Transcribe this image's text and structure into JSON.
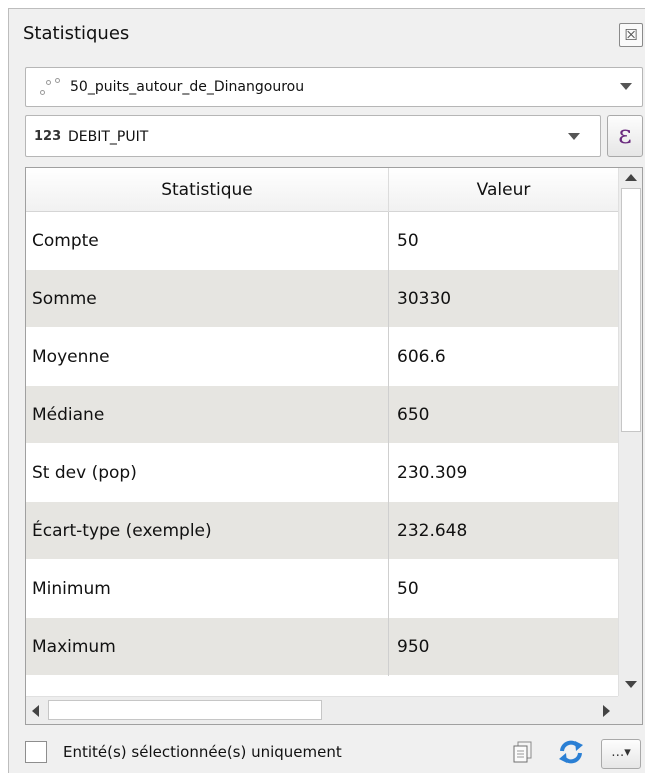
{
  "window": {
    "title": "Statistiques",
    "close_glyph": "☒"
  },
  "layer_select": {
    "value": "50_puits_autour_de_Dinangourou",
    "icon": "point-layer-icon"
  },
  "field_select": {
    "type_badge": "123",
    "value": "DEBIT_PUIT",
    "icon": "numeric-field-icon"
  },
  "expression_button": {
    "label": "ε"
  },
  "table": {
    "columns": [
      "Statistique",
      "Valeur"
    ],
    "rows": [
      {
        "stat": "Compte",
        "value": "50"
      },
      {
        "stat": "Somme",
        "value": "30330"
      },
      {
        "stat": "Moyenne",
        "value": "606.6"
      },
      {
        "stat": "Médiane",
        "value": "650"
      },
      {
        "stat": "St dev (pop)",
        "value": "230.309"
      },
      {
        "stat": "Écart-type (exemple)",
        "value": "232.648"
      },
      {
        "stat": "Minimum",
        "value": "50"
      },
      {
        "stat": "Maximum",
        "value": "950"
      }
    ]
  },
  "footer": {
    "selected_only_label": "Entité(s) sélectionnée(s) uniquement",
    "selected_only_checked": false,
    "more_label": "…▾"
  },
  "colors": {
    "alt_row": "#e6e5e1",
    "expression_accent": "#6a2a7e",
    "refresh_accent": "#2a7fd4"
  }
}
